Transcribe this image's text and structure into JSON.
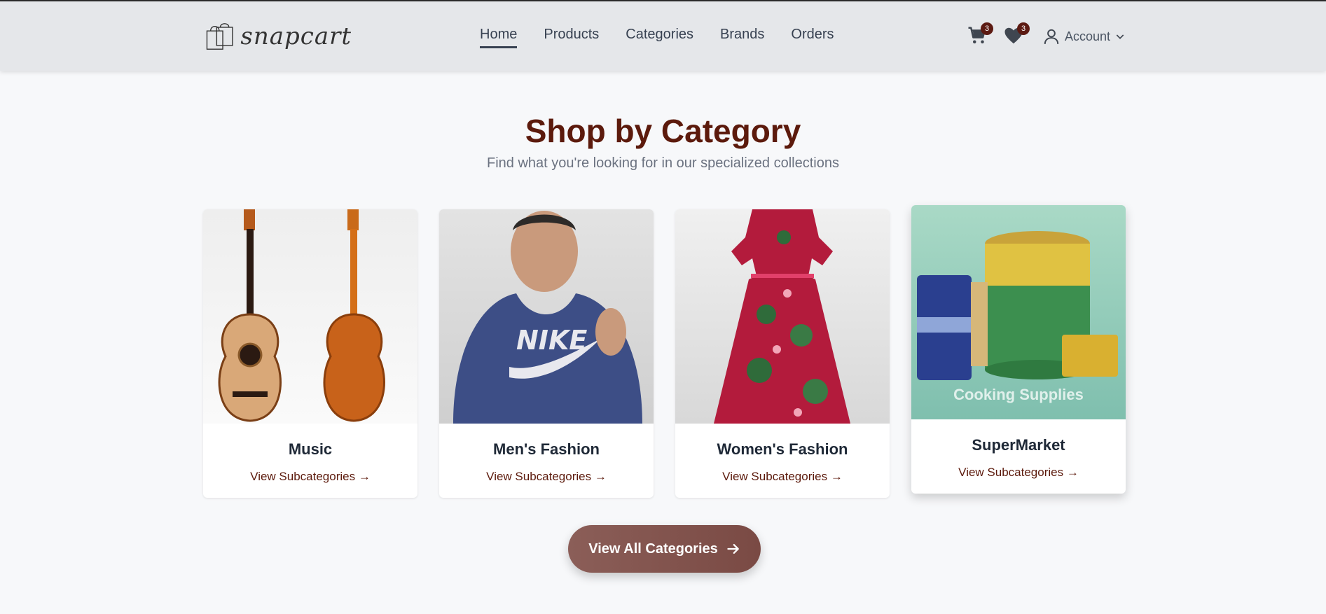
{
  "brand": {
    "name": "snapcart"
  },
  "nav": {
    "links": [
      {
        "label": "Home",
        "active": true
      },
      {
        "label": "Products"
      },
      {
        "label": "Categories"
      },
      {
        "label": "Brands"
      },
      {
        "label": "Orders"
      }
    ],
    "cart_count": "3",
    "wishlist_count": "3",
    "account_label": "Account"
  },
  "section": {
    "title": "Shop by Category",
    "subtitle": "Find what you're looking for in our specialized collections"
  },
  "cards": [
    {
      "name": "Music",
      "link": "View Subcategories →"
    },
    {
      "name": "Men's Fashion",
      "link": "View Subcategories →"
    },
    {
      "name": "Women's Fashion",
      "link": "View Subcategories →"
    },
    {
      "name": "SuperMarket",
      "link": "View Subcategories →",
      "overlay": "Cooking Supplies"
    }
  ],
  "cta": {
    "label": "View All Categories"
  },
  "colors": {
    "accent": "#5c1a0c",
    "button": "#7a4a44",
    "navbar": "#e5e7ea"
  }
}
